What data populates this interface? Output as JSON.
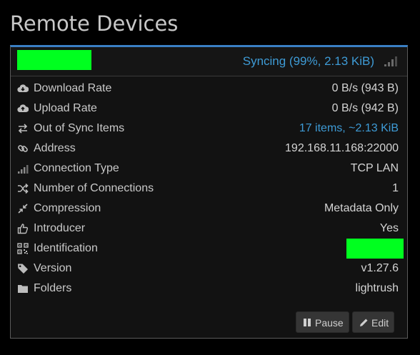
{
  "page": {
    "title": "Remote Devices"
  },
  "device": {
    "status": "Syncing (99%, 2.13 KiB)",
    "status_color": "#3e9bd6",
    "accent_color": "#3a7fc4",
    "redaction_color": "#00ff1f",
    "signal_icon": "signal-bars-icon"
  },
  "rows": [
    {
      "icon": "cloud-download-icon",
      "label": "Download Rate",
      "value": "0 B/s (943 B)"
    },
    {
      "icon": "cloud-upload-icon",
      "label": "Upload Rate",
      "value": "0 B/s (942 B)"
    },
    {
      "icon": "exchange-arrows-icon",
      "label": "Out of Sync Items",
      "value": "17 items, ~2.13 KiB"
    },
    {
      "icon": "link-icon",
      "label": "Address",
      "value": "192.168.11.168:22000"
    },
    {
      "icon": "signal-bars-icon",
      "label": "Connection Type",
      "value": "TCP LAN"
    },
    {
      "icon": "random-arrows-icon",
      "label": "Number of Connections",
      "value": "1"
    },
    {
      "icon": "compress-icon",
      "label": "Compression",
      "value": "Metadata Only"
    },
    {
      "icon": "thumbs-up-icon",
      "label": "Introducer",
      "value": "Yes"
    },
    {
      "icon": "qrcode-icon",
      "label": "Identification",
      "value": ""
    },
    {
      "icon": "tag-icon",
      "label": "Version",
      "value": "v1.27.6"
    },
    {
      "icon": "folder-icon",
      "label": "Folders",
      "value": "lightrush"
    }
  ],
  "actions": {
    "pause_label": "Pause",
    "edit_label": "Edit"
  }
}
